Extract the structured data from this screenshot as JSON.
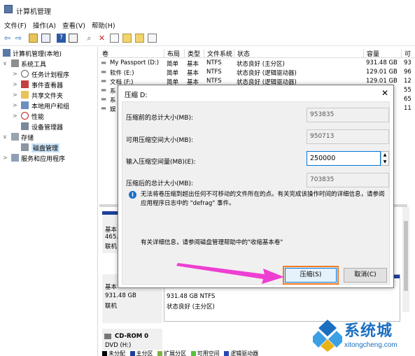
{
  "window": {
    "title": "计算机管理"
  },
  "menu": [
    "文件(F)",
    "操作(A)",
    "查看(V)",
    "帮助(H)"
  ],
  "tree": [
    {
      "label": "计算机管理(本地)",
      "level": 0,
      "expander": ""
    },
    {
      "label": "系统工具",
      "level": 1,
      "expander": "∨"
    },
    {
      "label": "任务计划程序",
      "level": 2,
      "expander": ">"
    },
    {
      "label": "事件查看器",
      "level": 2,
      "expander": ">"
    },
    {
      "label": "共享文件夹",
      "level": 2,
      "expander": ">"
    },
    {
      "label": "本地用户和组",
      "level": 2,
      "expander": ">"
    },
    {
      "label": "性能",
      "level": 2,
      "expander": ">"
    },
    {
      "label": "设备管理器",
      "level": 2,
      "expander": ""
    },
    {
      "label": "存储",
      "level": 1,
      "expander": "∨"
    },
    {
      "label": "磁盘管理",
      "level": 2,
      "expander": "",
      "selected": true
    },
    {
      "label": "服务和应用程序",
      "level": 1,
      "expander": ">"
    }
  ],
  "volume_columns": [
    "卷",
    "布局",
    "类型",
    "文件系统",
    "状态",
    "容量",
    "可"
  ],
  "volumes": [
    {
      "name": "My Passport (D:)",
      "layout": "简单",
      "type": "基本",
      "fs": "NTFS",
      "status": "状态良好 (主分区)",
      "capacity": "931.48 GB",
      "free": "93"
    },
    {
      "name": "软件 (E:)",
      "layout": "简单",
      "type": "基本",
      "fs": "NTFS",
      "status": "状态良好 (逻辑驱动器)",
      "capacity": "129.01 GB",
      "free": "96"
    },
    {
      "name": "文档 (F:)",
      "layout": "简单",
      "type": "基本",
      "fs": "NTFS",
      "status": "状态良好 (逻辑驱动器)",
      "capacity": "129.01 GB",
      "free": "12"
    },
    {
      "name": "系",
      "layout": "",
      "type": "",
      "fs": "",
      "status": "",
      "capacity": "",
      "free": "55"
    },
    {
      "name": "系",
      "layout": "",
      "type": "",
      "fs": "",
      "status": "",
      "capacity": "",
      "free": "65"
    },
    {
      "name": "娱",
      "layout": "",
      "type": "",
      "fs": "",
      "status": "",
      "capacity": "",
      "free": "11"
    }
  ],
  "disks": [
    {
      "line1": "基本",
      "line2": "465.",
      "line3": "联机"
    },
    {
      "line1": "基本",
      "line2": "931.48 GB",
      "line3": "联机"
    }
  ],
  "partition_d": {
    "size": "931.48 GB NTFS",
    "status": "状态良好 (主分区)"
  },
  "cdrom": {
    "name": "CD-ROM 0",
    "drive": "DVD (H:)"
  },
  "legend": [
    "未分配",
    "主分区",
    "扩展分区",
    "可用空间",
    "逻辑驱动器"
  ],
  "legend_colors": [
    "#000000",
    "#1d3f9a",
    "#7bb342",
    "#56c23b",
    "#2747b8"
  ],
  "dialog": {
    "title": "压缩 D:",
    "close": "✕",
    "fields": [
      {
        "label": "压缩前的总计大小(MB):",
        "value": "953835"
      },
      {
        "label": "可用压缩空间大小(MB):",
        "value": "950713"
      },
      {
        "label": "输入压缩空间量(MB)(E):",
        "value": "250000"
      },
      {
        "label": "压缩后的总计大小(MB):",
        "value": "703835"
      }
    ],
    "info": "无法将卷压缩到超出任何不可移动的文件所在的点。有关完成该操作时间的详细信息，请参阅应用程序日志中的 \"defrag\" 事件。",
    "help": "有关详细信息，请参阅磁盘管理帮助中的\"收缩基本卷\"",
    "shrink_button": "压缩(S)",
    "cancel_button": "取消(C)"
  },
  "watermark": {
    "text": "系统城",
    "url": "xitongcheng.com"
  },
  "colors": {
    "accent": "#0078d7",
    "highlight": "#f07b22",
    "arrow": "#ee3fd2",
    "partition_bar": "#1d3f9a"
  }
}
